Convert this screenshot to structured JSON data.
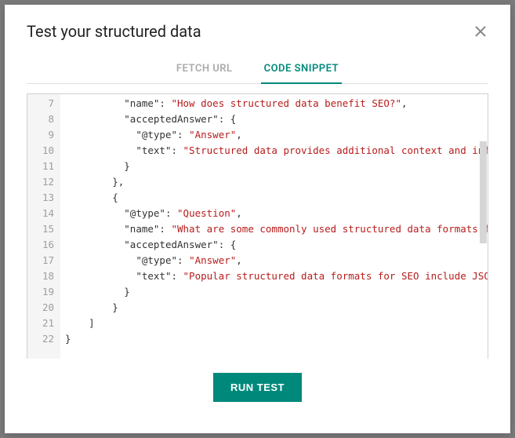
{
  "title": "Test your structured data",
  "tabs": {
    "fetch": "FETCH URL",
    "snippet": "CODE SNIPPET"
  },
  "editor": {
    "startLine": 7,
    "lines": [
      {
        "indent": 5,
        "tokens": [
          {
            "t": "key",
            "v": "\"name\""
          },
          {
            "t": "pun",
            "v": ": "
          },
          {
            "t": "str",
            "v": "\"How does structured data benefit SEO?\""
          },
          {
            "t": "pun",
            "v": ","
          }
        ]
      },
      {
        "indent": 5,
        "tokens": [
          {
            "t": "key",
            "v": "\"acceptedAnswer\""
          },
          {
            "t": "pun",
            "v": ": {"
          }
        ]
      },
      {
        "indent": 6,
        "tokens": [
          {
            "t": "key",
            "v": "\"@type\""
          },
          {
            "t": "pun",
            "v": ": "
          },
          {
            "t": "str",
            "v": "\"Answer\""
          },
          {
            "t": "pun",
            "v": ","
          }
        ]
      },
      {
        "indent": 6,
        "tokens": [
          {
            "t": "key",
            "v": "\"text\""
          },
          {
            "t": "pun",
            "v": ": "
          },
          {
            "t": "str",
            "v": "\"Structured data provides additional context and information"
          }
        ]
      },
      {
        "indent": 5,
        "tokens": [
          {
            "t": "pun",
            "v": "}"
          }
        ]
      },
      {
        "indent": 4,
        "tokens": [
          {
            "t": "pun",
            "v": "},"
          }
        ]
      },
      {
        "indent": 4,
        "tokens": [
          {
            "t": "pun",
            "v": "{"
          }
        ]
      },
      {
        "indent": 5,
        "tokens": [
          {
            "t": "key",
            "v": "\"@type\""
          },
          {
            "t": "pun",
            "v": ": "
          },
          {
            "t": "str",
            "v": "\"Question\""
          },
          {
            "t": "pun",
            "v": ","
          }
        ]
      },
      {
        "indent": 5,
        "tokens": [
          {
            "t": "key",
            "v": "\"name\""
          },
          {
            "t": "pun",
            "v": ": "
          },
          {
            "t": "str",
            "v": "\"What are some commonly used structured data formats for SEO?\""
          }
        ]
      },
      {
        "indent": 5,
        "tokens": [
          {
            "t": "key",
            "v": "\"acceptedAnswer\""
          },
          {
            "t": "pun",
            "v": ": {"
          }
        ]
      },
      {
        "indent": 6,
        "tokens": [
          {
            "t": "key",
            "v": "\"@type\""
          },
          {
            "t": "pun",
            "v": ": "
          },
          {
            "t": "str",
            "v": "\"Answer\""
          },
          {
            "t": "pun",
            "v": ","
          }
        ]
      },
      {
        "indent": 6,
        "tokens": [
          {
            "t": "key",
            "v": "\"text\""
          },
          {
            "t": "pun",
            "v": ": "
          },
          {
            "t": "str",
            "v": "\"Popular structured data formats for SEO include JSON-LD (rec"
          }
        ]
      },
      {
        "indent": 5,
        "tokens": [
          {
            "t": "pun",
            "v": "}"
          }
        ]
      },
      {
        "indent": 4,
        "tokens": [
          {
            "t": "pun",
            "v": "}"
          }
        ]
      },
      {
        "indent": 2,
        "tokens": [
          {
            "t": "pun",
            "v": "]"
          }
        ]
      },
      {
        "indent": 0,
        "tokens": [
          {
            "t": "pun",
            "v": "}"
          }
        ]
      }
    ]
  },
  "runButton": "RUN TEST"
}
